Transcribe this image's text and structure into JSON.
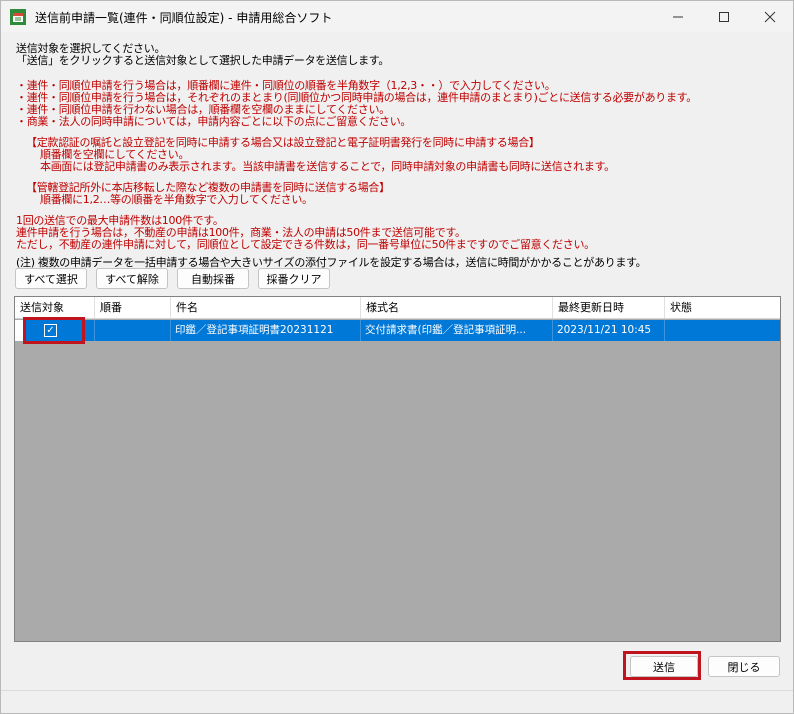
{
  "window": {
    "title": "送信前申請一覧(連件・同順位設定) - 申請用総合ソフト",
    "icon": "app-icon"
  },
  "instructions": {
    "lines": [
      "送信対象を選択してください。",
      "「送信」をクリックすると送信対象として選択した申請データを送信します。"
    ],
    "red_lines": [
      "・連件・同順位申請を行う場合は，順番欄に連件・同順位の順番を半角数字（1,2,3・・）で入力してください。",
      "・連件・同順位申請を行う場合は，それぞれのまとまり(同順位かつ同時申請の場合は，連件申請のまとまり)ごとに送信する必要があります。",
      "・連件・同順位申請を行わない場合は，順番欄を空欄のままにしてください。",
      "・商業・法人の同時申請については，申請内容ごとに以下の点にご留意ください。"
    ],
    "section1": {
      "title": "【定款認証の嘱託と設立登記を同時に申請する場合又は設立登記と電子証明書発行を同時に申請する場合】",
      "line1": "順番欄を空欄にしてください。",
      "line2": "本画面には登記申請書のみ表示されます。当該申請書を送信することで，同時申請対象の申請書も同時に送信されます。"
    },
    "section2": {
      "title": "【管轄登記所外に本店移転した際など複数の申請書を同時に送信する場合】",
      "line1": "順番欄に1,2…等の順番を半角数字で入力してください。"
    },
    "limits": [
      "1回の送信での最大申請件数は100件です。",
      "連件申請を行う場合は，不動産の申請は100件，商業・法人の申請は50件まで送信可能です。",
      "ただし，不動産の連件申請に対して，同順位として設定できる件数は，同一番号単位に50件まですのでご留意ください。"
    ],
    "note": "(注) 複数の申請データを一括申請する場合や大きいサイズの添付ファイルを設定する場合は，送信に時間がかかることがあります。"
  },
  "toolbar": {
    "select_all": "すべて選択",
    "deselect_all": "すべて解除",
    "auto_number": "自動採番",
    "clear_number": "採番クリア"
  },
  "table": {
    "columns": [
      "送信対象",
      "順番",
      "件名",
      "様式名",
      "最終更新日時",
      "状態"
    ],
    "rows": [
      {
        "selected": true,
        "order": "",
        "subject": "印鑑／登記事項証明書20231121",
        "form": "交付請求書(印鑑／登記事項証明...",
        "updated": "2023/11/21 10:45",
        "status": ""
      }
    ]
  },
  "footer": {
    "send": "送信",
    "close": "閉じる"
  },
  "colors": {
    "selection": "#0078d7",
    "warning_text": "#c00000",
    "highlight_box": "#c0141f",
    "grid_empty": "#aaaaaa"
  }
}
